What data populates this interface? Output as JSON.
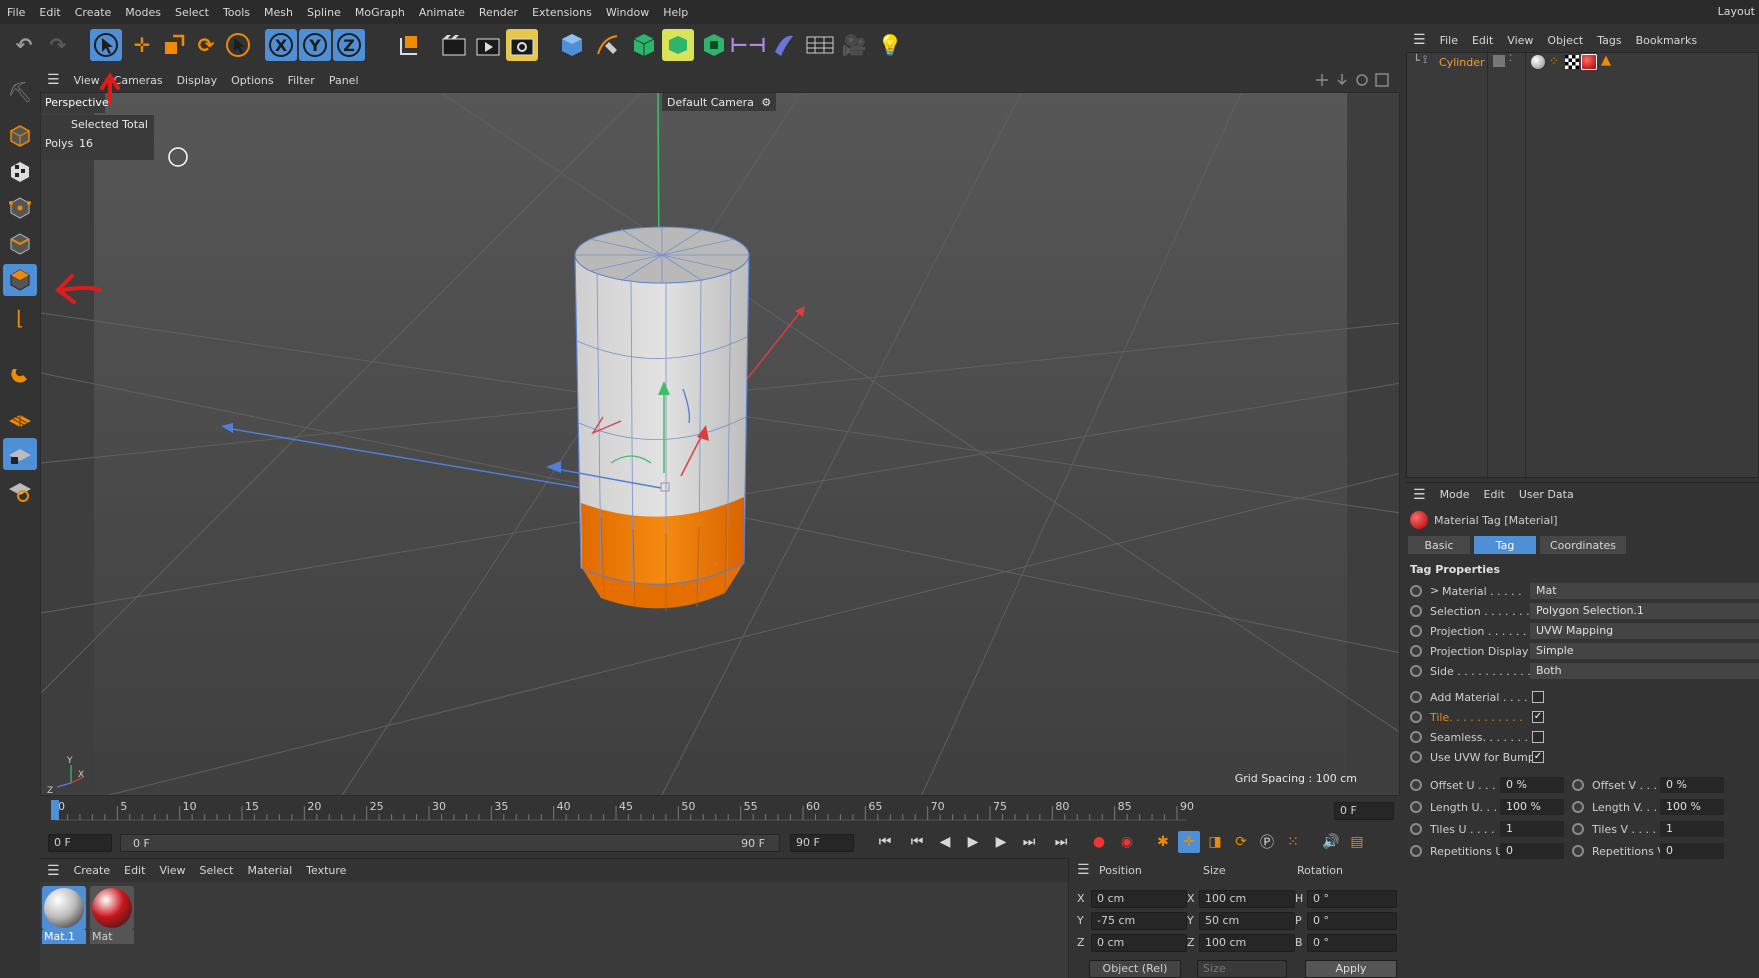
{
  "menubar": {
    "items": [
      "File",
      "Edit",
      "Create",
      "Modes",
      "Select",
      "Tools",
      "Mesh",
      "Spline",
      "MoGraph",
      "Animate",
      "Render",
      "Extensions",
      "Window",
      "Help"
    ],
    "layout_label": "Layout"
  },
  "viewport": {
    "menu": [
      "View",
      "Cameras",
      "Display",
      "Options",
      "Filter",
      "Panel"
    ],
    "view_name": "Perspective",
    "camera": "Default Camera",
    "stats_header": "Selected Total",
    "stats_label": "Polys",
    "stats_value": "16",
    "grid_spacing": "Grid Spacing : 100 cm",
    "axis_labels": {
      "y": "Y",
      "x": "X",
      "z": "Z"
    }
  },
  "timeline": {
    "ticks": [
      "0",
      "5",
      "10",
      "15",
      "20",
      "25",
      "30",
      "35",
      "40",
      "45",
      "50",
      "55",
      "60",
      "65",
      "70",
      "75",
      "80",
      "85",
      "90"
    ],
    "current_frame_field": "0 F",
    "start_field": "0 F",
    "range_start": "0 F",
    "range_end": "90 F",
    "end_field": "90 F"
  },
  "material_manager": {
    "menu": [
      "Create",
      "Edit",
      "View",
      "Select",
      "Material",
      "Texture"
    ],
    "materials": [
      {
        "name": "Mat.1",
        "color": "#bdbdbd",
        "selected": true
      },
      {
        "name": "Mat",
        "color": "#c8161d",
        "selected": false
      }
    ]
  },
  "coordinates": {
    "headers": [
      "Position",
      "Size",
      "Rotation"
    ],
    "rows": [
      {
        "axis": "X",
        "pos": "0 cm",
        "size_axis": "X",
        "size": "100 cm",
        "rot_axis": "H",
        "rot": "0 °"
      },
      {
        "axis": "Y",
        "pos": "-75 cm",
        "size_axis": "Y",
        "size": "50 cm",
        "rot_axis": "P",
        "rot": "0 °"
      },
      {
        "axis": "Z",
        "pos": "0 cm",
        "size_axis": "Z",
        "size": "100 cm",
        "rot_axis": "B",
        "rot": "0 °"
      }
    ],
    "mode": "Object (Rel)",
    "size_mode": "Size",
    "apply": "Apply"
  },
  "object_manager": {
    "menu": [
      "File",
      "Edit",
      "View",
      "Object",
      "Tags",
      "Bookmarks"
    ],
    "objects": [
      {
        "name": "Cylinder"
      }
    ]
  },
  "attributes": {
    "menu": [
      "Mode",
      "Edit",
      "User Data"
    ],
    "title": "Material Tag [Material]",
    "tabs": [
      "Basic",
      "Tag",
      "Coordinates"
    ],
    "active_tab": "Tag",
    "section": "Tag Properties",
    "props": [
      {
        "label": "Material . . . . .",
        "value": "Mat",
        "expand": ">"
      },
      {
        "label": "Selection . . . . . . .",
        "value": "Polygon Selection.1"
      },
      {
        "label": "Projection . . . . . .",
        "value": "UVW Mapping"
      },
      {
        "label": "Projection Display",
        "value": "Simple"
      },
      {
        "label": "Side . . . . . . . . . . .",
        "value": "Both"
      }
    ],
    "checks": [
      {
        "label": "Add Material . . . .",
        "checked": false,
        "highlight": false
      },
      {
        "label": "Tile. . . . . . . . . . .",
        "checked": true,
        "highlight": true
      },
      {
        "label": "Seamless. . . . . . .",
        "checked": false,
        "highlight": false
      },
      {
        "label": "Use UVW for Bump",
        "checked": true,
        "highlight": false
      }
    ],
    "pairs": [
      {
        "l1": "Offset U . . .",
        "v1": "0 %",
        "l2": "Offset V . . .",
        "v2": "0 %"
      },
      {
        "l1": "Length U. . .",
        "v1": "100 %",
        "l2": "Length V. . .",
        "v2": "100 %"
      },
      {
        "l1": "Tiles U . . . .",
        "v1": "1",
        "l2": "Tiles V . . . .",
        "v2": "1"
      },
      {
        "l1": "Repetitions U",
        "v1": "0",
        "l2": "Repetitions V",
        "v2": "0"
      }
    ]
  },
  "colors": {
    "accent": "#4f8fd6",
    "orange": "#f07a00",
    "annotation": "#e11b1b"
  }
}
